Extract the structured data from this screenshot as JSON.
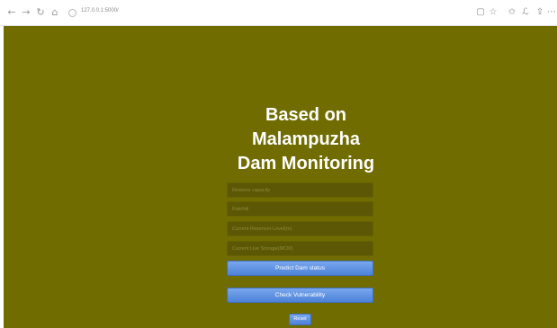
{
  "browser": {
    "back_icon": "←",
    "forward_icon": "→",
    "reload_icon": "↻",
    "home_icon": "⌂",
    "url": "127.0.0.1:5000/",
    "reader_icon": "▢",
    "bookmark_star_icon": "☆",
    "favorites_icon": "✩",
    "collections_icon": "ℒ",
    "share_icon": "⇪",
    "more_icon": "⋯"
  },
  "page": {
    "title_line1": "Based on",
    "title_line2": "Malampuzha",
    "title_line3": "Dam Monitoring",
    "fields": {
      "reservoir_capacity_placeholder": "Reserve capacity",
      "rainfall_placeholder": "Rainfall",
      "current_reservoir_level_placeholder": "Current Reservoir Level(m)",
      "current_live_storage_placeholder": "Current Live Storage(MCM)"
    },
    "buttons": {
      "predict": "Predict Dam status",
      "check": "Check Vulnerability",
      "reset": "Reset"
    },
    "colors": {
      "background": "#706c00",
      "button_blue": "#5a8ee0"
    }
  }
}
